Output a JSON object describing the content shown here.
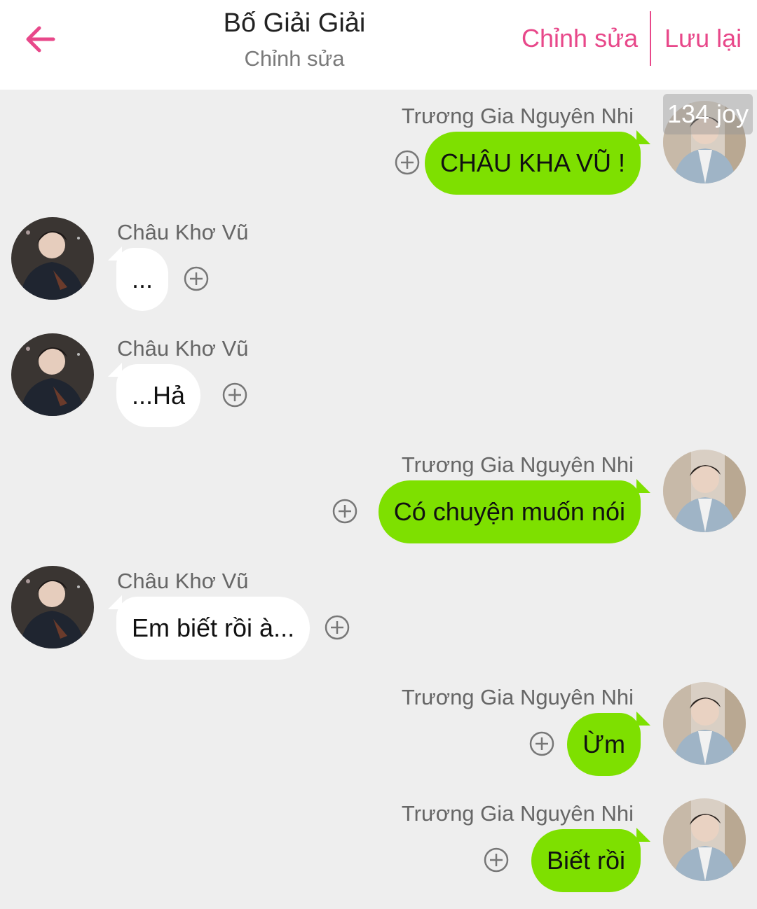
{
  "header": {
    "title": "Bố Giải Giải",
    "subtitle": "Chỉnh sửa",
    "edit_label": "Chỉnh sửa",
    "save_label": "Lưu lại"
  },
  "watermark": "134 joy",
  "colors": {
    "accent": "#e8488a",
    "sent_bubble": "#7ee000",
    "received_bubble": "#ffffff",
    "background": "#eeeeee"
  },
  "messages": [
    {
      "side": "right",
      "sender": "Trương Gia Nguyên Nhi",
      "text": "CHÂU KHA VŨ !"
    },
    {
      "side": "left",
      "sender": "Châu Khơ Vũ",
      "text": "..."
    },
    {
      "side": "left",
      "sender": "Châu Khơ Vũ",
      "text": "...Hả"
    },
    {
      "side": "right",
      "sender": "Trương Gia Nguyên Nhi",
      "text": "Có chuyện muốn nói"
    },
    {
      "side": "left",
      "sender": "Châu Khơ Vũ",
      "text": "Em biết rồi à..."
    },
    {
      "side": "right",
      "sender": "Trương Gia Nguyên Nhi",
      "text": "Ừm"
    },
    {
      "side": "right",
      "sender": "Trương Gia Nguyên Nhi",
      "text": "Biết rồi"
    }
  ]
}
